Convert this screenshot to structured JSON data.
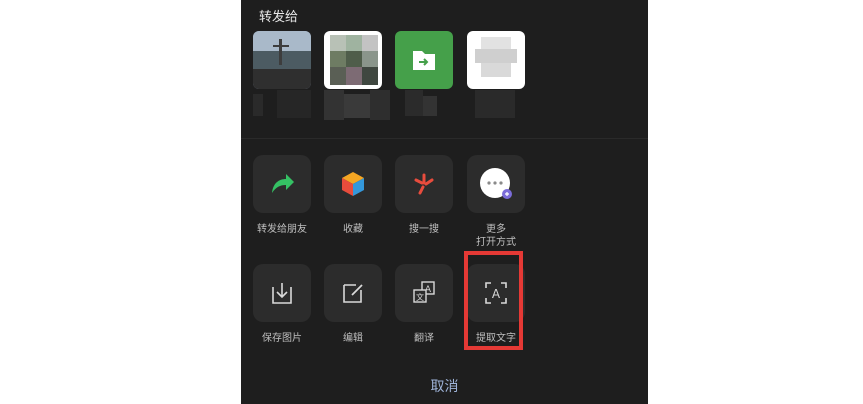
{
  "share": {
    "title": "转发给"
  },
  "recipients": [
    {
      "avatar": "landscape-avatar",
      "colors": [
        "#6f7f93",
        "#8fa6b5",
        "#3b3b3b",
        "#5a5a4a"
      ]
    },
    {
      "avatar": "pixelated-avatar",
      "colors": [
        "#9aa9a0",
        "#7d8b7c",
        "#5c6b55",
        "#c9d1c7"
      ]
    },
    {
      "avatar": "folder-icon",
      "accent": "#45a04a"
    },
    {
      "avatar": "pixelated-white-avatar",
      "colors": [
        "#f1f1f1",
        "#d9d9d9",
        "#bdbdbd"
      ]
    }
  ],
  "actions_row1": [
    {
      "label": "转发给朋友",
      "icon": "forward-arrow-icon",
      "color": "#35c164"
    },
    {
      "label": "收藏",
      "icon": "favorite-cube-icon",
      "color": "#f5a623"
    },
    {
      "label": "搜一搜",
      "icon": "search-spark-icon",
      "color": "#e84c3d"
    },
    {
      "label": "更多\n打开方式",
      "icon": "more-open-icon",
      "color": "#ffffff"
    }
  ],
  "actions_row2": [
    {
      "label": "保存图片",
      "icon": "save-image-icon"
    },
    {
      "label": "编辑",
      "icon": "edit-icon"
    },
    {
      "label": "翻译",
      "icon": "translate-icon"
    },
    {
      "label": "提取文字",
      "icon": "extract-text-icon"
    }
  ],
  "cancel_label": "取消",
  "colors": {
    "sheet_bg": "#1e1e1e",
    "tile_bg": "#2c2c2c",
    "highlight": "#e53935",
    "cancel": "#9fb4d9"
  }
}
